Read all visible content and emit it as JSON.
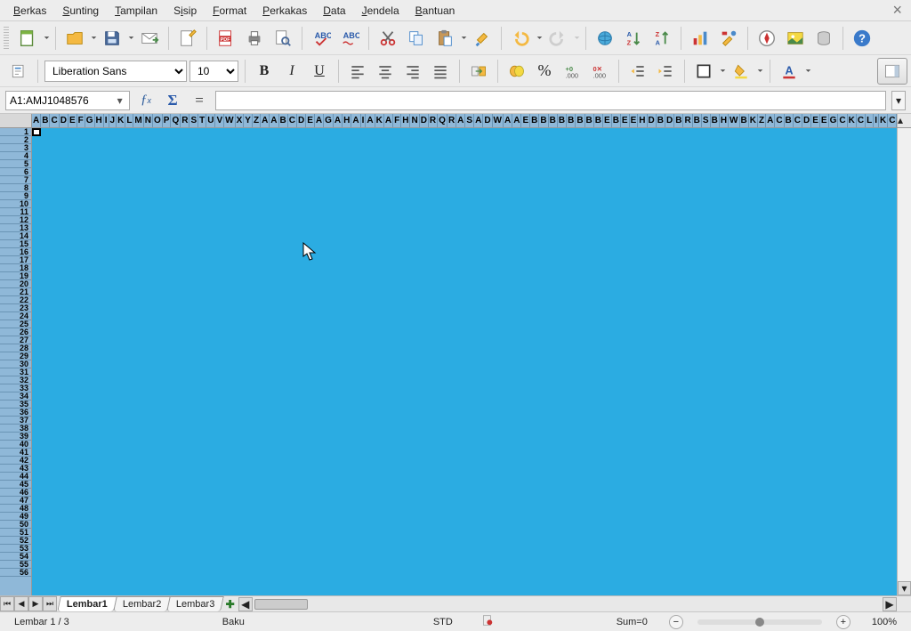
{
  "menu": {
    "items": [
      "Berkas",
      "Sunting",
      "Tampilan",
      "Sisip",
      "Format",
      "Perkakas",
      "Data",
      "Jendela",
      "Bantuan"
    ]
  },
  "format": {
    "font": "Liberation Sans",
    "size": "10"
  },
  "formula": {
    "namebox": "A1:AMJ1048576",
    "input": ""
  },
  "tabs": {
    "items": [
      "Lembar1",
      "Lembar2",
      "Lembar3"
    ],
    "active": 0
  },
  "status": {
    "sheet": "Lembar 1 / 3",
    "style": "Baku",
    "mode": "STD",
    "sum": "Sum=0",
    "zoom": "100%"
  },
  "colheaders": "ABCDEFGHIJKLMNOPQRSTUVWXYZAABCDEAGAHAIAKAFHNDRQRASADWAAEBBBBBBBBEBEEHDBDBRBSBHWBKZACBCDEEGCKCLIKCMNOPQRSTCWWKYDADBDBD",
  "rowcount": 56
}
